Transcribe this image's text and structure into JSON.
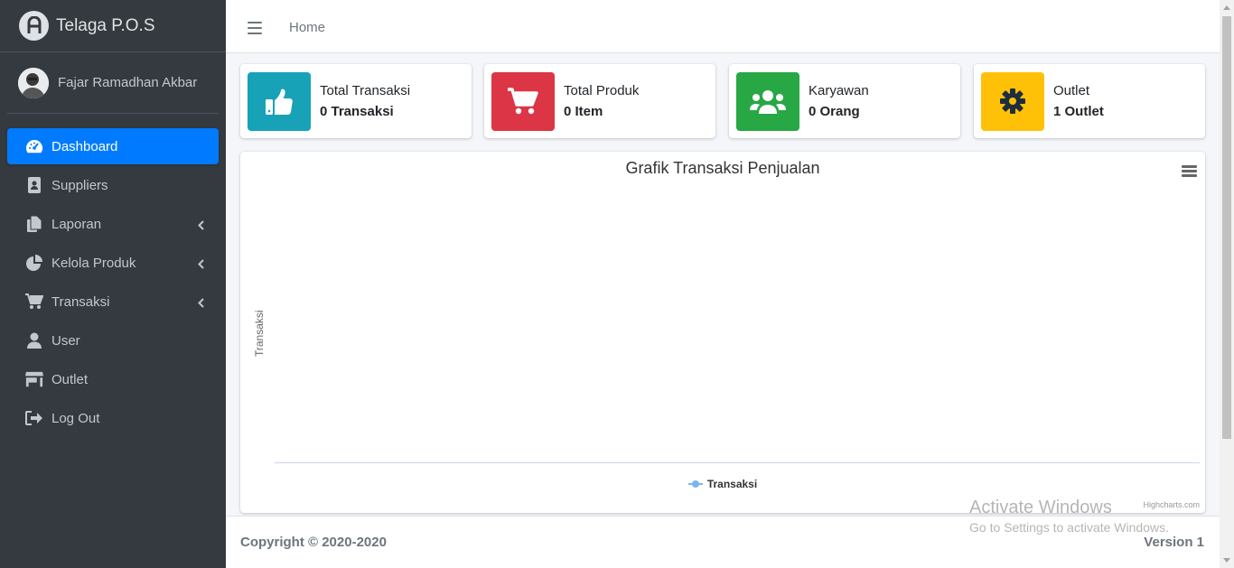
{
  "brand": {
    "name": "Telaga P.O.S"
  },
  "user": {
    "name": "Fajar Ramadhan Akbar"
  },
  "sidebar": {
    "items": [
      {
        "label": "Dashboard",
        "icon": "tachometer-icon"
      },
      {
        "label": "Suppliers",
        "icon": "address-book-icon"
      },
      {
        "label": "Laporan",
        "icon": "copy-icon"
      },
      {
        "label": "Kelola Produk",
        "icon": "chart-pie-icon"
      },
      {
        "label": "Transaksi",
        "icon": "cart-icon"
      },
      {
        "label": "User",
        "icon": "user-icon"
      },
      {
        "label": "Outlet",
        "icon": "store-icon"
      },
      {
        "label": "Log Out",
        "icon": "sign-out-icon"
      }
    ]
  },
  "navbar": {
    "home": "Home"
  },
  "info_boxes": [
    {
      "title": "Total Transaksi",
      "value": "0 Transaksi",
      "color": "#17a2b8",
      "icon": "thumbs-up-icon"
    },
    {
      "title": "Total Produk",
      "value": "0 Item",
      "color": "#dc3545",
      "icon": "cart-icon"
    },
    {
      "title": "Karyawan",
      "value": "0 Orang",
      "color": "#28a745",
      "icon": "users-icon"
    },
    {
      "title": "Outlet",
      "value": "1 Outlet",
      "color": "#ffc107",
      "icon": "cog-icon"
    }
  ],
  "chart_data": {
    "type": "line",
    "title": "Grafik Transaksi Penjualan",
    "ylabel": "Transaksi",
    "xlabel": "",
    "series": [
      {
        "name": "Transaksi",
        "values": []
      }
    ],
    "legend": "bottom",
    "credits": "Highcharts.com"
  },
  "footer": {
    "copyright": "Copyright © 2020-2020",
    "version": "Version 1"
  },
  "watermark": {
    "title": "Activate Windows",
    "subtitle": "Go to Settings to activate Windows."
  },
  "colors": {
    "sidebar_bg": "#343a40",
    "accent": "#007bff"
  }
}
